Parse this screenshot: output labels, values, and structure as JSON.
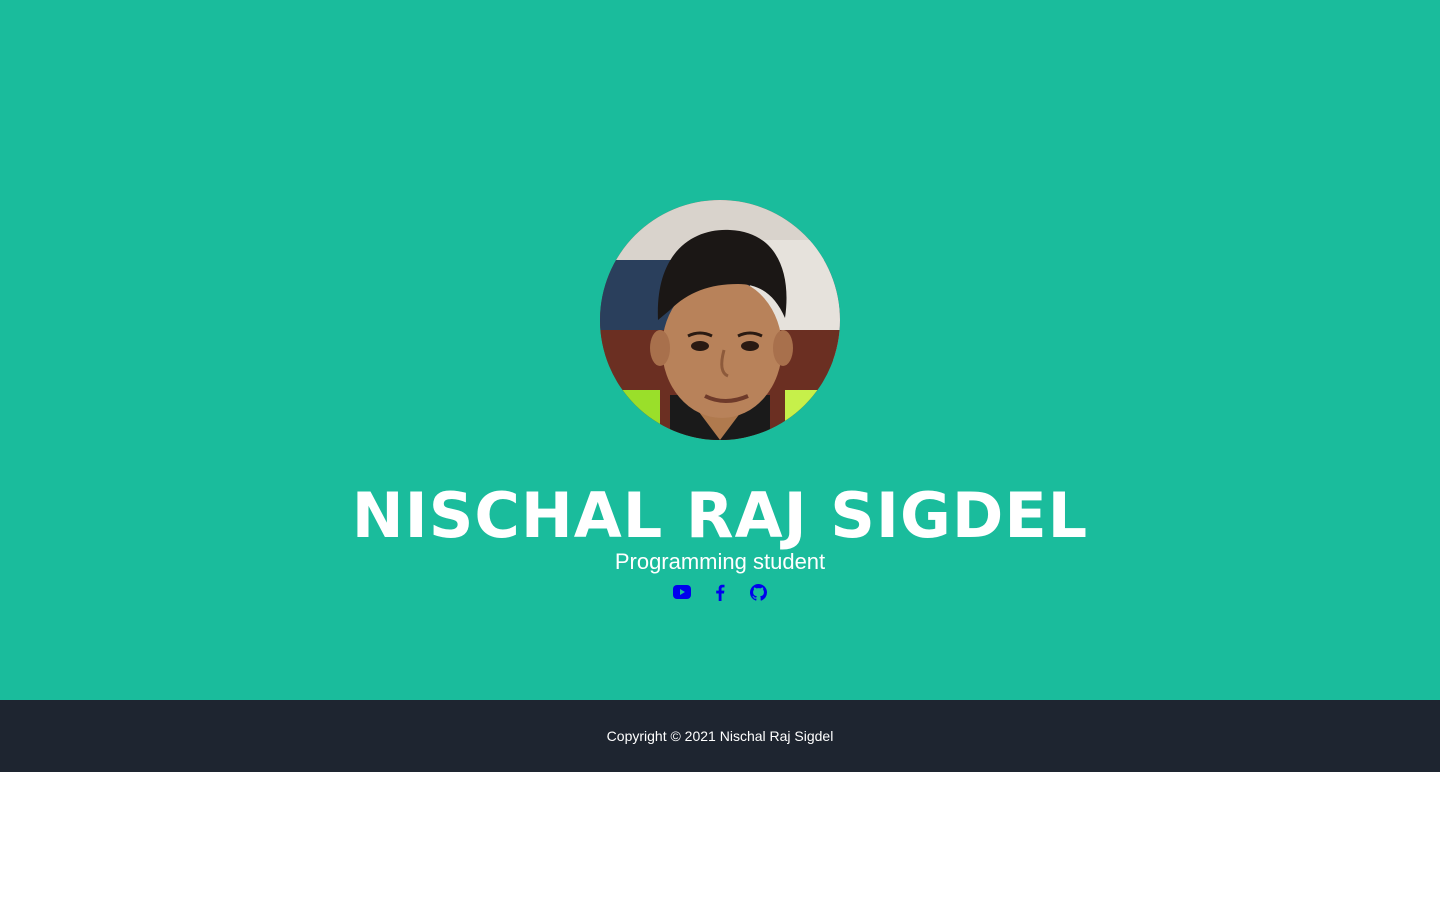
{
  "profile": {
    "name": "NISCHAL RAJ SIGDEL",
    "subtitle": "Programming student",
    "avatar_alt": "profile photo"
  },
  "social": [
    {
      "icon": "youtube-icon",
      "color": "#0000ee"
    },
    {
      "icon": "facebook-icon",
      "color": "#0000ee"
    },
    {
      "icon": "github-icon",
      "color": "#0000ee"
    }
  ],
  "footer": {
    "copyright": "Copyright © 2021 Nischal Raj Sigdel"
  },
  "colors": {
    "hero_bg": "#1abc9c",
    "footer_bg": "#1e2530",
    "text": "#ffffff",
    "link": "#0000ee"
  }
}
